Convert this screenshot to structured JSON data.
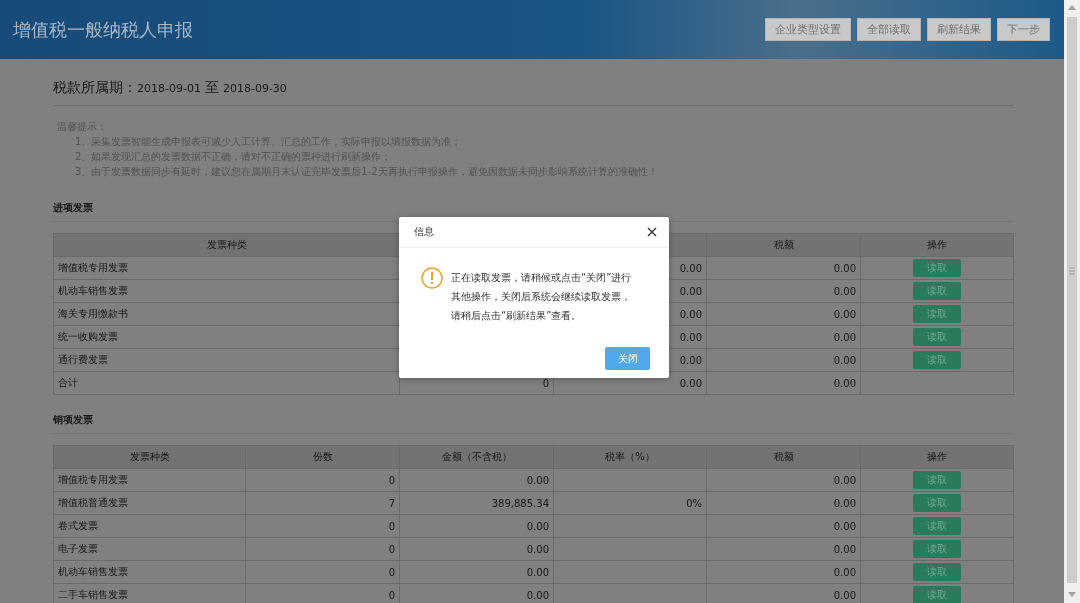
{
  "header": {
    "title": "增值税一般纳税人申报",
    "buttons": [
      "企业类型设置",
      "全部读取",
      "刷新结果",
      "下一步"
    ]
  },
  "period": {
    "label": "税款所属期：",
    "start": "2018-09-01",
    "separator": "至",
    "end": "2018-09-30"
  },
  "tips": {
    "title": "温馨提示：",
    "items": [
      "1、采集发票智能生成申报表可减少人工计算、汇总的工作，实际申报以填报数据为准；",
      "2、如果发现汇总的发票数据不正确，请对不正确的票种进行刷新操作；",
      "3、由于发票数据同步有延时，建议您在属期月末认证完毕发票后1-2天再执行申报操作，避免因数据未同步影响系统计算的准确性！"
    ]
  },
  "sections": [
    {
      "title": "进项发票",
      "columns": [
        "发票种类",
        null,
        null,
        "税额",
        "操作"
      ],
      "rows": [
        {
          "cells": [
            "增值税专用发票",
            null,
            "0.00",
            "0.00"
          ],
          "action": "读取"
        },
        {
          "cells": [
            "机动车销售发票",
            null,
            "0.00",
            "0.00"
          ],
          "action": "读取"
        },
        {
          "cells": [
            "海关专用缴款书",
            null,
            "0.00",
            "0.00"
          ],
          "action": "读取"
        },
        {
          "cells": [
            "统一收购发票",
            null,
            "0.00",
            "0.00"
          ],
          "action": "读取"
        },
        {
          "cells": [
            "通行费发票",
            null,
            "0.00",
            "0.00"
          ],
          "action": "读取"
        },
        {
          "cells": [
            "合计",
            "0",
            "0.00",
            "0.00"
          ]
        }
      ]
    },
    {
      "title": "销项发票",
      "columns": [
        "发票种类",
        "份数",
        "金额（不含税）",
        "税率（%）",
        "税额",
        "操作"
      ],
      "rows": [
        {
          "cells": [
            "增值税专用发票",
            "0",
            "0.00",
            null,
            "0.00"
          ],
          "action": "读取"
        },
        {
          "cells": [
            "增值税普通发票",
            "7",
            "389,885.34",
            "0%",
            "0.00"
          ],
          "action": "读取"
        },
        {
          "cells": [
            "卷式发票",
            "0",
            "0.00",
            null,
            "0.00"
          ],
          "action": "读取"
        },
        {
          "cells": [
            "电子发票",
            "0",
            "0.00",
            null,
            "0.00"
          ],
          "action": "读取"
        },
        {
          "cells": [
            "机动车销售发票",
            "0",
            "0.00",
            null,
            "0.00"
          ],
          "action": "读取"
        },
        {
          "cells": [
            "二手车销售发票",
            "0",
            "0.00",
            null,
            "0.00"
          ],
          "action": "读取"
        }
      ]
    }
  ],
  "dialog": {
    "title": "信息",
    "message": "正在读取发票，请稍候或点击“关闭”进行其他操作，关闭后系统会继续读取发票，请稍后点击“刷新结果”查看。",
    "button": "关闭"
  }
}
